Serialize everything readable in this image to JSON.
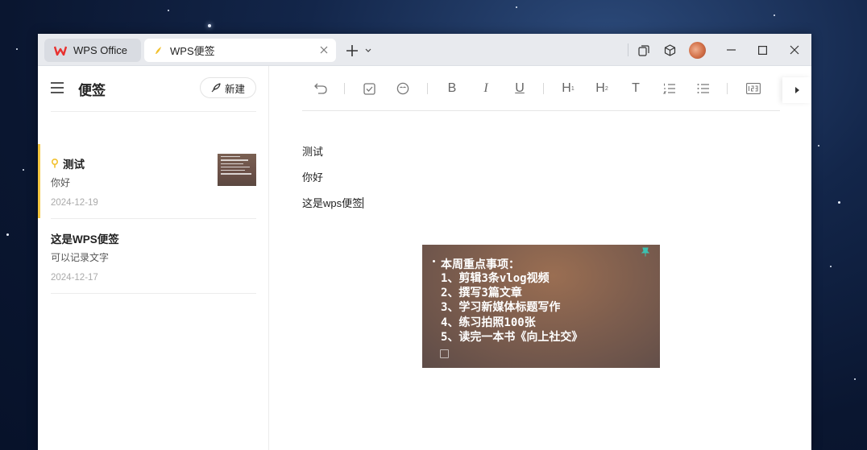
{
  "titlebar": {
    "tabs": [
      {
        "label": "WPS Office",
        "icon": "wps-logo-icon",
        "active": false
      },
      {
        "label": "WPS便签",
        "icon": "note-pen-icon",
        "active": true
      }
    ],
    "buttons": [
      "new-tab-icon",
      "dropdown-icon",
      "restore-window-icon",
      "cube-icon",
      "avatar",
      "minimize-icon",
      "maximize-icon",
      "close-icon"
    ]
  },
  "sidebar": {
    "title": "便签",
    "new_button": "新建",
    "notes": [
      {
        "title": "测试",
        "preview": "你好",
        "date": "2024-12-19",
        "pinned": true,
        "has_thumbnail": true
      },
      {
        "title": "这是WPS便签",
        "preview": "可以记录文字",
        "date": "2024-12-17",
        "pinned": false,
        "has_thumbnail": false
      }
    ]
  },
  "editor": {
    "toolbar": [
      "undo-icon",
      "checkbox-icon",
      "emoji-icon",
      "bold-icon",
      "italic-icon",
      "underline-icon",
      "heading1-icon",
      "heading2-icon",
      "text-icon",
      "numbered-list-icon",
      "bullet-list-icon",
      "number-format-icon",
      "more-icon"
    ],
    "toolbar_glyphs": {
      "bold": "B",
      "italic": "I",
      "underline": "U",
      "h1": "H",
      "h2": "H",
      "text": "T"
    },
    "lines": [
      "测试",
      "你好",
      "这是wps便签"
    ],
    "image": {
      "title": "本周重点事项：",
      "items": [
        "1、剪辑3条vlog视频",
        "2、撰写3篇文章",
        "3、学习新媒体标题写作",
        "4、练习拍照100张",
        "5、读完一本书《向上社交》"
      ]
    }
  },
  "colors": {
    "accent_bar": "#f5c842",
    "wps_red": "#e8312f",
    "pin": "#3cc0b0"
  }
}
